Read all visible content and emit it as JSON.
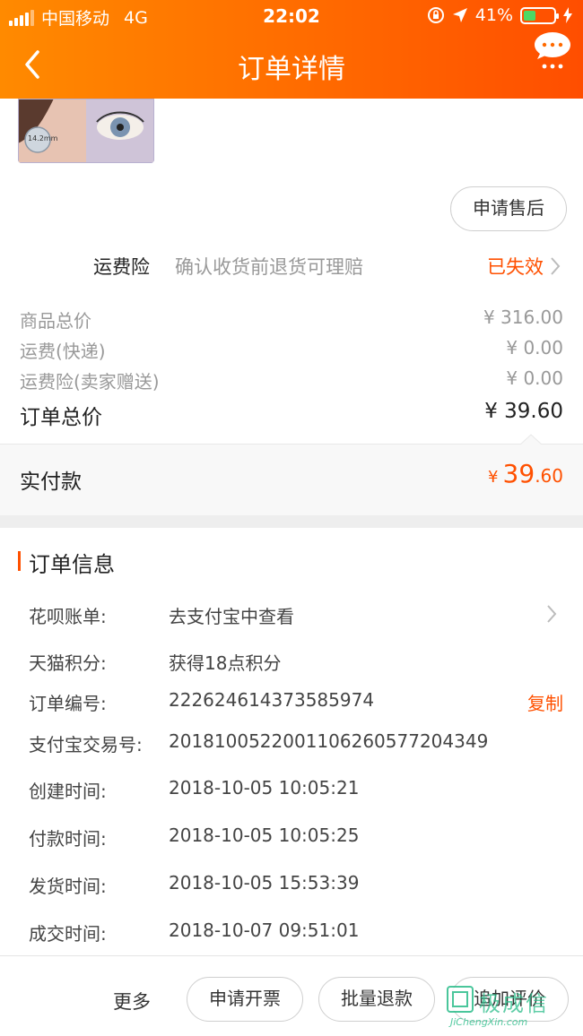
{
  "status_bar": {
    "carrier": "中国移动",
    "network": "4G",
    "time": "22:02",
    "battery": "41%",
    "battery_level": 0.41
  },
  "nav": {
    "title": "订单详情",
    "back_icon": "chevron-left-icon",
    "more_icon": "more-dots-icon"
  },
  "product": {
    "thumb_text": "14.2mm"
  },
  "after_sale_label": "申请售后",
  "freight_insurance": {
    "label": "运费险",
    "desc": "确认收货前退货可理赔",
    "status": "已失效"
  },
  "price_lines": [
    {
      "label": "商品总价",
      "value": "¥ 316.00"
    },
    {
      "label": "运费(快递)",
      "value": "¥ 0.00"
    },
    {
      "label": "运费险(卖家赠送)",
      "value": "¥ 0.00"
    }
  ],
  "order_total": {
    "label": "订单总价",
    "value": "¥ 39.60"
  },
  "paid": {
    "label": "实付款",
    "currency": "¥",
    "integer": "39",
    "decimal": ".60"
  },
  "order_info": {
    "title": "订单信息",
    "rows": [
      {
        "key": "花呗账单:",
        "value": "去支付宝中查看"
      },
      {
        "key": "天猫积分:",
        "value": "获得18点积分"
      },
      {
        "key": "订单编号:",
        "value": "222624614373585974",
        "action": "复制"
      },
      {
        "key": "支付宝交易号:",
        "value": "2018100522001106260577204349"
      },
      {
        "key": "创建时间:",
        "value": "2018-10-05 10:05:21"
      },
      {
        "key": "付款时间:",
        "value": "2018-10-05 10:05:25"
      },
      {
        "key": "发货时间:",
        "value": "2018-10-05 15:53:39"
      },
      {
        "key": "成交时间:",
        "value": "2018-10-07 09:51:01"
      }
    ]
  },
  "bottom_bar": {
    "more": "更多",
    "invoice": "申请开票",
    "batch_refund": "批量退款",
    "add_review": "追加评价"
  },
  "watermark": {
    "main": "极成信",
    "sub": "JiChengXin.com"
  },
  "colors": {
    "accent": "#ff5000",
    "header_start": "#ff8a00",
    "header_end": "#ff4e00"
  }
}
